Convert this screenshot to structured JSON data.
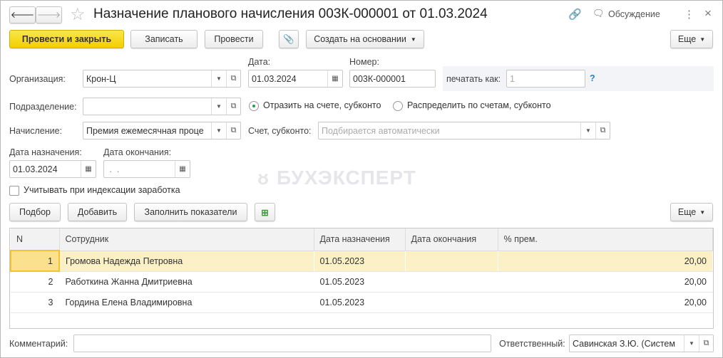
{
  "title": "Назначение планового начисления 003К-000001 от 01.03.2024",
  "header": {
    "discussion": "Обсуждение",
    "close": "×",
    "more": "⋮"
  },
  "toolbar": {
    "post_close": "Провести и закрыть",
    "save": "Записать",
    "post": "Провести",
    "create_based": "Создать на основании",
    "more": "Еще"
  },
  "form": {
    "org_label": "Организация:",
    "org_value": "Крон-Ц",
    "date_label": "Дата:",
    "date_value": "01.03.2024",
    "number_label": "Номер:",
    "number_value": "003К-000001",
    "print_as_label": "печатать как:",
    "print_as_value": "1",
    "help": "?",
    "division_label": "Подразделение:",
    "division_value": "",
    "radio1": "Отразить на счете, субконто",
    "radio2": "Распределить по счетам, субконто",
    "accrual_label": "Начисление:",
    "accrual_value": "Премия ежемесячная проце",
    "account_label": "Счет, субконто:",
    "account_placeholder": "Подбирается автоматически",
    "start_label": "Дата назначения:",
    "start_value": "01.03.2024",
    "end_label": "Дата окончания:",
    "end_value": " .  .",
    "indexation_label": "Учитывать при индексации заработка"
  },
  "watermark": "БУХЭКСПЕРТ",
  "table_toolbar": {
    "pick": "Подбор",
    "add": "Добавить",
    "fill": "Заполнить показатели",
    "more": "Еще"
  },
  "table": {
    "headers": [
      "N",
      "Сотрудник",
      "Дата назначения",
      "Дата окончания",
      "% прем."
    ],
    "rows": [
      [
        "1",
        "Громова Надежда Петровна",
        "01.05.2023",
        "",
        "20,00"
      ],
      [
        "2",
        "Работкина Жанна Дмитриевна",
        "01.05.2023",
        "",
        "20,00"
      ],
      [
        "3",
        "Гордина Елена Владимировна",
        "01.05.2023",
        "",
        "20,00"
      ]
    ]
  },
  "footer": {
    "comment_label": "Комментарий:",
    "comment_value": "",
    "responsible_label": "Ответственный:",
    "responsible_value": "Савинская З.Ю. (Систем"
  }
}
